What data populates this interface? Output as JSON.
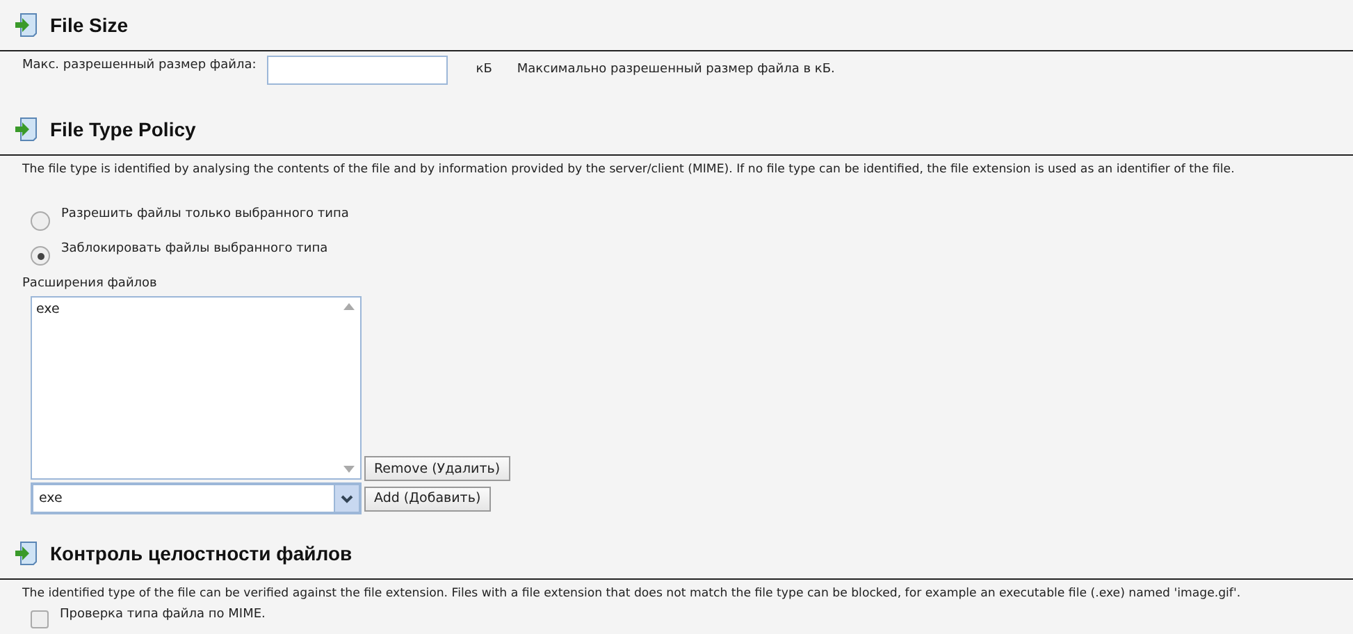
{
  "sections": [
    {
      "kind": "size",
      "title": "File Size",
      "field_label": "Макс. разрешенный размер файла:",
      "unit": "кБ",
      "hint": "Максимально разрешенный размер файла в кБ."
    },
    {
      "kind": "policy",
      "title": "File Type Policy",
      "description": "The file type is identified by analysing the contents of the file and by information provided by the server/client (MIME). If no file type can be identified, the file extension is used as an identifier of the file.",
      "options": [
        {
          "label": "Разрешить файлы только выбранного типа",
          "selected": false
        },
        {
          "label": "Заблокировать файлы выбранного типа",
          "selected": true
        }
      ],
      "list_label": "Расширения файлов",
      "extensions": [
        "exe"
      ],
      "combo_value": "exe",
      "remove_button": "Remove (Удалить)",
      "add_button": "Add (Добавить)"
    },
    {
      "kind": "integrity",
      "title": "Контроль целостности файлов",
      "description": "The identified type of the file can be verified against the file extension. Files with a file extension that does not match the file type can be blocked, for example an executable file (.exe) named 'image.gif'.",
      "checkbox": {
        "label": "Проверка типа файла по MIME.",
        "checked": false
      }
    }
  ]
}
